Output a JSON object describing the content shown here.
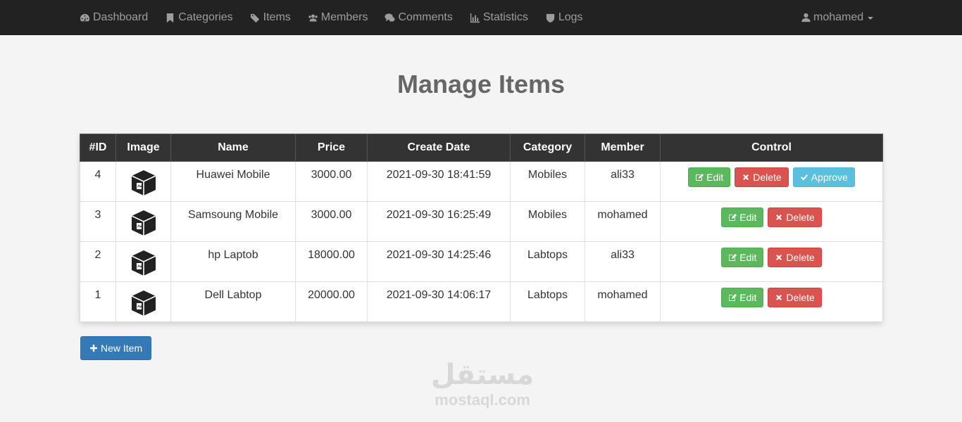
{
  "nav": {
    "items": [
      {
        "label": "Dashboard",
        "icon": "dashboard-icon"
      },
      {
        "label": "Categories",
        "icon": "bookmark-icon"
      },
      {
        "label": "Items",
        "icon": "tags-icon"
      },
      {
        "label": "Members",
        "icon": "users-icon"
      },
      {
        "label": "Comments",
        "icon": "comments-icon"
      },
      {
        "label": "Statistics",
        "icon": "bar-chart-icon"
      },
      {
        "label": "Logs",
        "icon": "shield-icon"
      }
    ],
    "user": "mohamed"
  },
  "page": {
    "title": "Manage Items"
  },
  "table": {
    "headers": [
      "#ID",
      "Image",
      "Name",
      "Price",
      "Create Date",
      "Category",
      "Member",
      "Control"
    ],
    "rows": [
      {
        "id": "4",
        "name": "Huawei Mobile",
        "price": "3000.00",
        "date": "2021-09-30 18:41:59",
        "category": "Mobiles",
        "member": "ali33",
        "approve": true
      },
      {
        "id": "3",
        "name": "Samsoung Mobile",
        "price": "3000.00",
        "date": "2021-09-30 16:25:49",
        "category": "Mobiles",
        "member": "mohamed",
        "approve": false
      },
      {
        "id": "2",
        "name": "hp Laptob",
        "price": "18000.00",
        "date": "2021-09-30 14:25:46",
        "category": "Labtops",
        "member": "ali33",
        "approve": false
      },
      {
        "id": "1",
        "name": "Dell Labtop",
        "price": "20000.00",
        "date": "2021-09-30 14:06:17",
        "category": "Labtops",
        "member": "mohamed",
        "approve": false
      }
    ],
    "buttons": {
      "edit": "Edit",
      "delete": "Delete",
      "approve": "Approve"
    }
  },
  "new_item_label": "New Item",
  "watermark": {
    "arabic": "مستقل",
    "latin": "mostaql.com"
  },
  "colors": {
    "success": "#5cb85c",
    "danger": "#d9534f",
    "info": "#5bc0de",
    "primary": "#337ab7",
    "navbar": "#222222"
  }
}
